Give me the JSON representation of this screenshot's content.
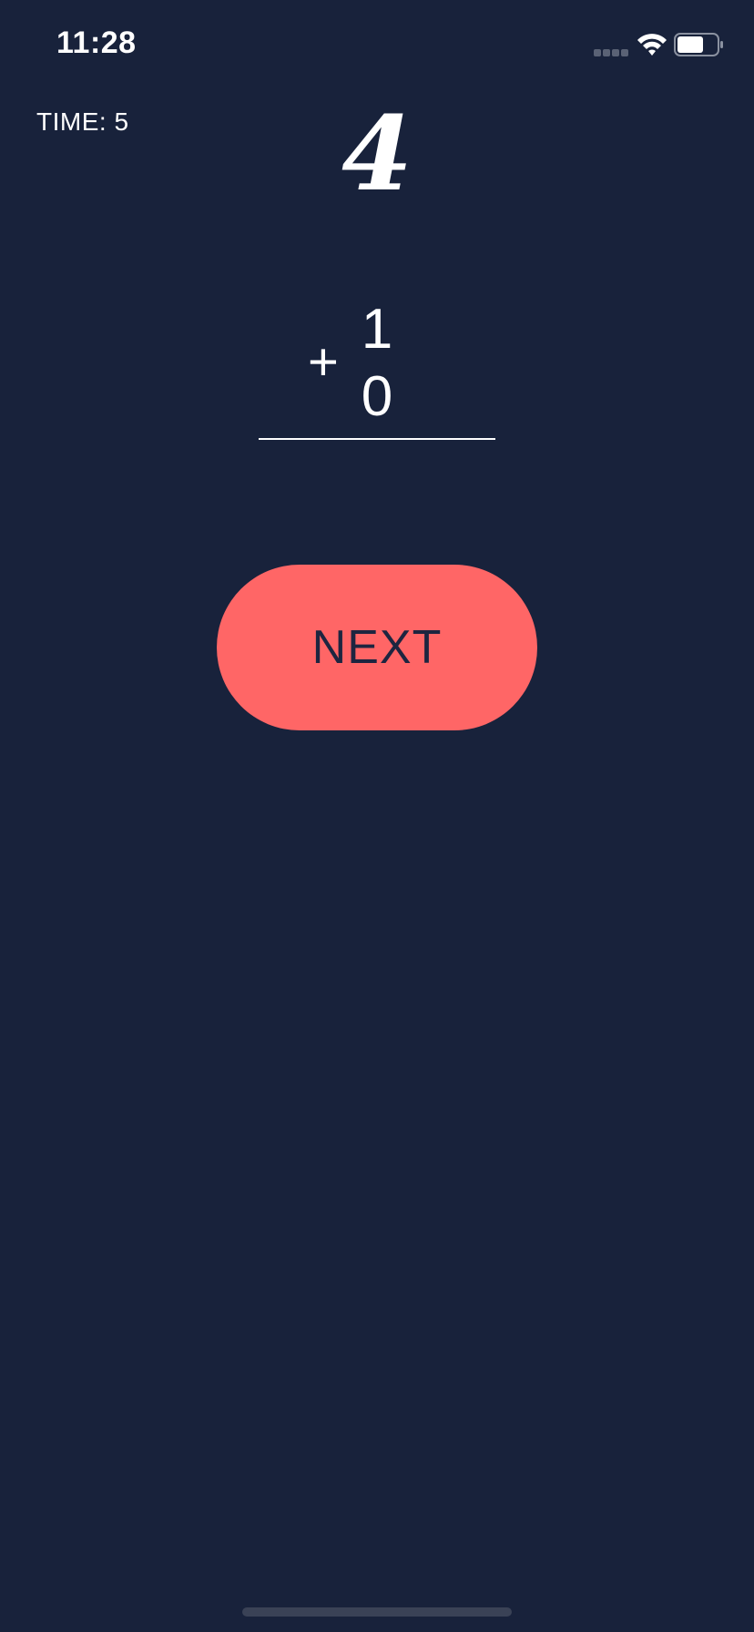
{
  "status_bar": {
    "time": "11:28",
    "icons": [
      "cellular-signal-icon",
      "wifi-icon",
      "battery-icon"
    ]
  },
  "game": {
    "timer_text": "TIME:  5",
    "answer": "4",
    "operand_top": "1",
    "operator": "+",
    "operand_bottom": "0"
  },
  "actions": {
    "next_label": "NEXT"
  },
  "colors": {
    "background": "#18223b",
    "button": "#ff6666",
    "button_text": "#1d2540",
    "text": "#ffffff"
  }
}
